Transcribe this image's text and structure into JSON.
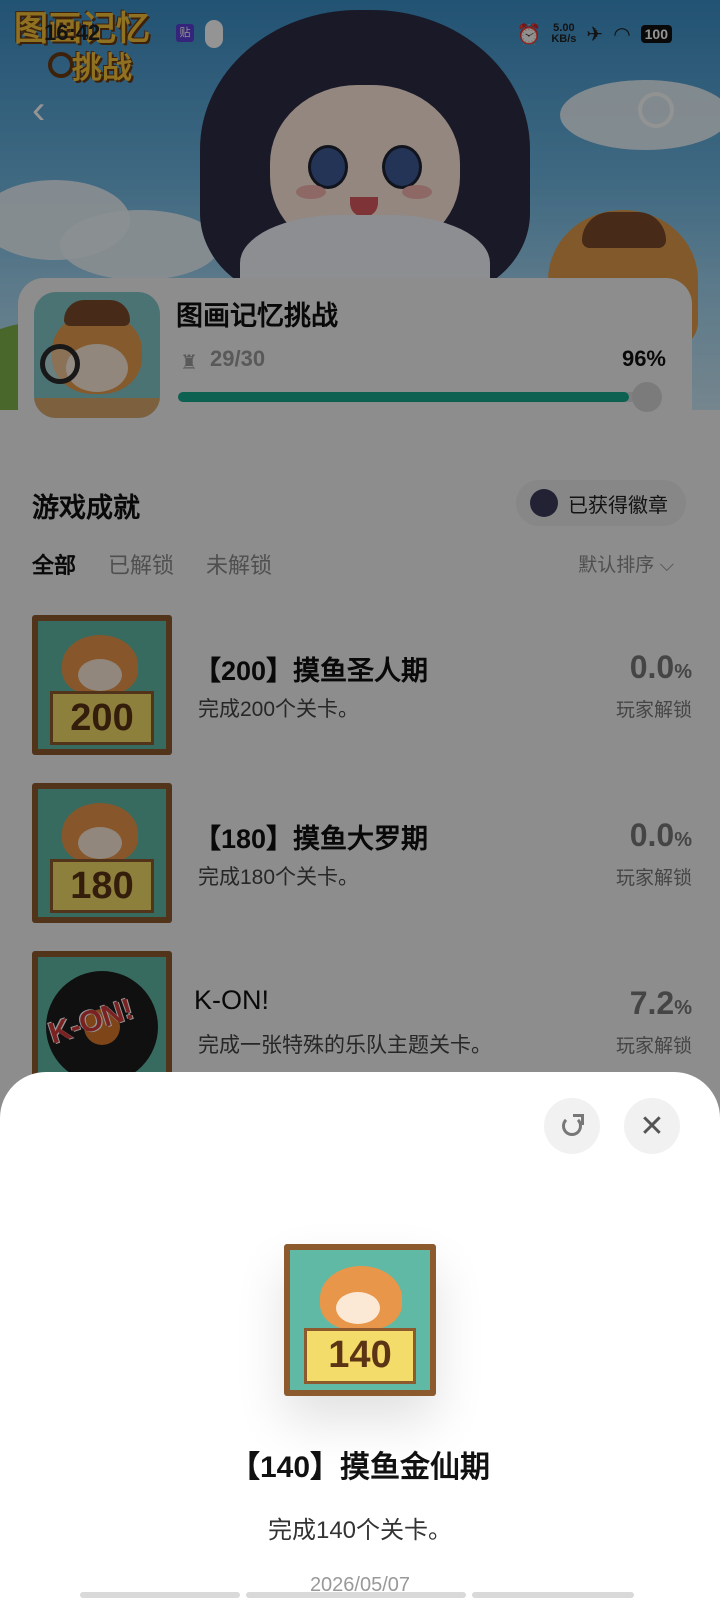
{
  "status_bar": {
    "time": "16:42",
    "net_speed_value": "5.00",
    "net_speed_unit": "KB/s",
    "battery": "100"
  },
  "game": {
    "title": "图画记忆挑战",
    "logo_line1": "图画记忆",
    "logo_line2": "挑战",
    "progress_count": "29/30",
    "progress_percent": "96%",
    "progress_fraction": 0.96
  },
  "achievements_section": {
    "title": "游戏成就",
    "badge_button": "已获得徽章",
    "tabs": [
      "全部",
      "已解锁",
      "未解锁"
    ],
    "active_tab": "全部",
    "sort_label": "默认排序"
  },
  "achievements": [
    {
      "badge_number": "200",
      "title": "【200】摸鱼圣人期",
      "desc": "完成200个关卡。",
      "pct": "0.0",
      "pct_unit": "%",
      "pct_label": "玩家解锁"
    },
    {
      "badge_number": "180",
      "title": "【180】摸鱼大罗期",
      "desc": "完成180个关卡。",
      "pct": "0.0",
      "pct_unit": "%",
      "pct_label": "玩家解锁"
    },
    {
      "badge_text": "K-ON!",
      "title": "K-ON!",
      "desc": "完成一张特殊的乐队主题关卡。",
      "pct": "7.2",
      "pct_unit": "%",
      "pct_label": "玩家解锁"
    }
  ],
  "sheet": {
    "badge_number": "140",
    "title": "【140】摸鱼金仙期",
    "desc": "完成140个关卡。",
    "date": "2026/05/07",
    "close_glyph": "✕"
  },
  "icons": {
    "back": "‹",
    "trophy": "♜",
    "chevron": "⌵"
  }
}
